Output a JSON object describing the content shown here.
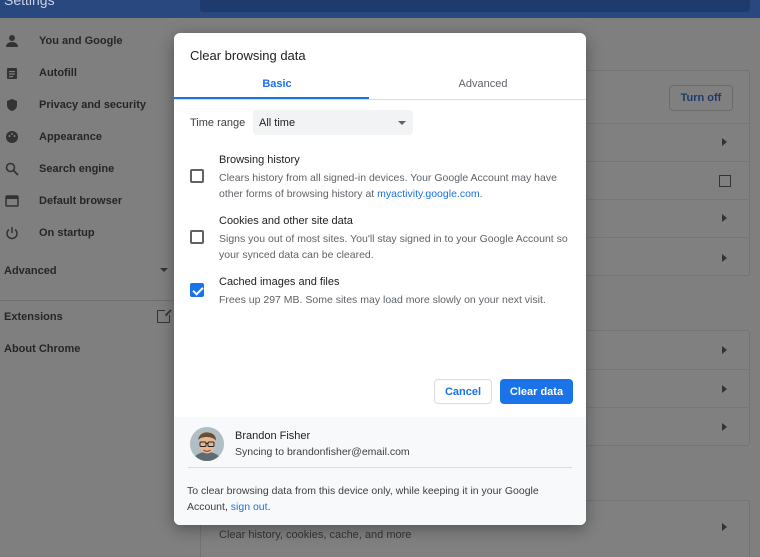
{
  "window": {
    "title": "Settings"
  },
  "sidebar": {
    "items": [
      {
        "label": "You and Google",
        "icon": "person-icon"
      },
      {
        "label": "Autofill",
        "icon": "clipboard-icon"
      },
      {
        "label": "Privacy and security",
        "icon": "shield-icon"
      },
      {
        "label": "Appearance",
        "icon": "palette-icon"
      },
      {
        "label": "Search engine",
        "icon": "search-icon"
      },
      {
        "label": "Default browser",
        "icon": "browser-icon"
      },
      {
        "label": "On startup",
        "icon": "power-icon"
      }
    ],
    "advanced_label": "Advanced",
    "extensions_label": "Extensions",
    "about_label": "About Chrome"
  },
  "background": {
    "turn_off_label": "Turn off",
    "bottom_row_text": "Clear history, cookies, cache, and more"
  },
  "dialog": {
    "title": "Clear browsing data",
    "tabs": [
      {
        "label": "Basic",
        "active": true
      },
      {
        "label": "Advanced",
        "active": false
      }
    ],
    "time_range": {
      "label": "Time range",
      "value": "All time"
    },
    "options": [
      {
        "title": "Browsing history",
        "desc_pre": "Clears history from all signed-in devices. Your Google Account may have other forms of browsing history at ",
        "link": "myactivity.google.com",
        "desc_post": ".",
        "checked": false
      },
      {
        "title": "Cookies and other site data",
        "desc_pre": "Signs you out of most sites. You'll stay signed in to your Google Account so your synced data can be cleared.",
        "link": "",
        "desc_post": "",
        "checked": false
      },
      {
        "title": "Cached images and files",
        "desc_pre": "Frees up 297 MB. Some sites may load more slowly on your next visit.",
        "link": "",
        "desc_post": "",
        "checked": true
      }
    ],
    "cancel_label": "Cancel",
    "clear_label": "Clear data",
    "account": {
      "name": "Brandon Fisher",
      "sync_text": "Syncing to brandonfisher@email.com"
    },
    "footer": {
      "text": "To clear browsing data from this device only, while keeping it in your Google Account, ",
      "link": "sign out",
      "end": "."
    }
  },
  "colors": {
    "accent": "#1a73e8",
    "backdrop": "#7f7f7f"
  }
}
